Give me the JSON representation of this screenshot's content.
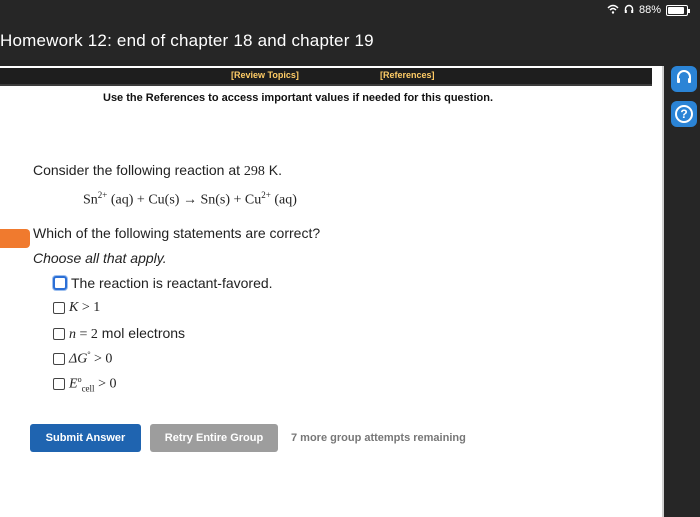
{
  "status": {
    "battery_percent": "88%",
    "wifi_icon": "wifi-icon",
    "headphones_icon": "headphones-icon"
  },
  "page_title": "Homework 12: end of chapter 18 and chapter 19",
  "toolbar": {
    "review_topics": "[Review Topics]",
    "references": "[References]"
  },
  "reference_note": "Use the References to access important values if needed for this question.",
  "question": {
    "intro_prefix": "Consider the following reaction at ",
    "temperature": "298",
    "intro_suffix": " K.",
    "equation": {
      "sn_ion": "Sn",
      "sn_charge": "2+",
      "sn_state": "(aq)",
      "plus1": "+",
      "cu_solid": "Cu(s)",
      "arrow": "→",
      "sn_solid": "Sn(s)",
      "plus2": "+",
      "cu_ion": "Cu",
      "cu_charge": "2+",
      "cu_state": "(aq)"
    },
    "prompt": "Which of the following statements are correct?",
    "instruction": "Choose all that apply.",
    "options": {
      "o1": "The reaction is reactant-favored.",
      "o2_var": "K",
      "o2_rel": " > 1",
      "o3_var": "n",
      "o3_rel": " = 2",
      "o3_text": " mol electrons",
      "o4_var": "ΔG",
      "o4_sup": "°",
      "o4_rel": " > 0",
      "o5_var": "E",
      "o5_sup": "o",
      "o5_sub": "cell",
      "o5_rel": " > 0"
    }
  },
  "buttons": {
    "submit": "Submit Answer",
    "retry": "Retry Entire Group"
  },
  "attempts_text": "7 more group attempts remaining",
  "side_buttons": {
    "help_symbol": "?"
  },
  "colors": {
    "primary": "#1f64b0",
    "secondary": "#9d9d9d",
    "accent_tab": "#f07a2e",
    "side_btn": "#2b84d6"
  }
}
